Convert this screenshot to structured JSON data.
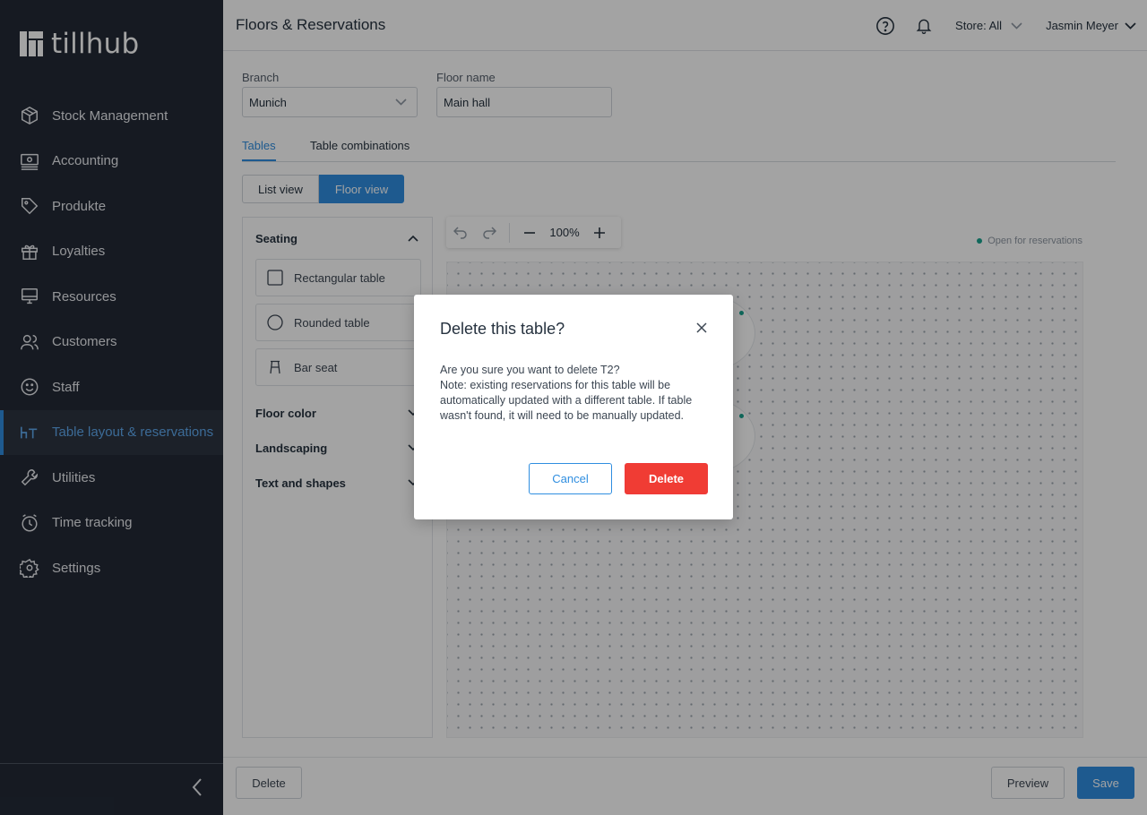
{
  "app": {
    "logo_text": "tillhub"
  },
  "sidebar": {
    "items": [
      {
        "label": "Stock Management",
        "icon": "box-icon"
      },
      {
        "label": "Accounting",
        "icon": "cash-register-icon"
      },
      {
        "label": "Produkte",
        "icon": "tag-icon"
      },
      {
        "label": "Loyalties",
        "icon": "gift-icon"
      },
      {
        "label": "Resources",
        "icon": "monitor-icon"
      },
      {
        "label": "Customers",
        "icon": "users-icon"
      },
      {
        "label": "Staff",
        "icon": "smiley-icon"
      },
      {
        "label": "Table layout & reservations",
        "icon": "table-layout-icon",
        "active": true
      },
      {
        "label": "Utilities",
        "icon": "wrench-icon"
      },
      {
        "label": "Time tracking",
        "icon": "clock-icon"
      },
      {
        "label": "Settings",
        "icon": "gear-icon"
      }
    ]
  },
  "header": {
    "title": "Floors & Reservations",
    "store_label": "Store: All",
    "user_name": "Jasmin Meyer"
  },
  "form": {
    "branch_label": "Branch",
    "branch_value": "Munich",
    "floor_name_label": "Floor name",
    "floor_name_value": "Main hall"
  },
  "tabs": {
    "tables": "Tables",
    "combinations": "Table combinations"
  },
  "view_toggle": {
    "list": "List view",
    "floor": "Floor view"
  },
  "panel": {
    "seating_title": "Seating",
    "items": {
      "rect": "Rectangular table",
      "round": "Rounded table",
      "bar": "Bar seat"
    },
    "floor_color": "Floor color",
    "landscaping": "Landscaping",
    "text_shapes": "Text and shapes"
  },
  "toolbar": {
    "zoom": "100%"
  },
  "legend": {
    "open_label": "Open for reservations",
    "open_color": "#1aa38f"
  },
  "bottom": {
    "delete": "Delete",
    "preview": "Preview",
    "save": "Save"
  },
  "modal": {
    "title": "Delete this table?",
    "line1": "Are you sure you want to delete T2?",
    "line2": "Note: existing reservations for this table will be automatically updated with a different table. If table wasn't found, it will need to be manually updated.",
    "cancel": "Cancel",
    "delete": "Delete"
  },
  "colors": {
    "accent": "#2f8ee0",
    "danger": "#f03c34",
    "sidebar_bg": "#232a36"
  }
}
